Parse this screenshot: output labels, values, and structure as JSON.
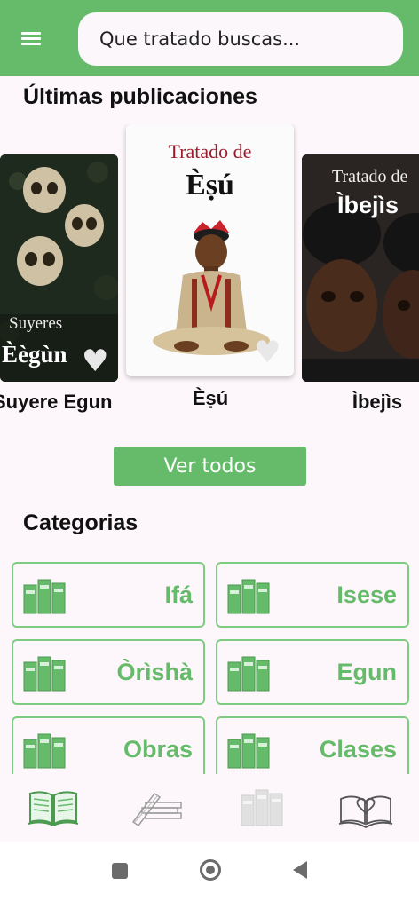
{
  "search": {
    "placeholder": "Que tratado buscas..."
  },
  "latest": {
    "title": "Últimas publicaciones",
    "books": [
      {
        "caption": "Suyere Egun",
        "cover_line1": "Suyeres",
        "cover_line2": "Èègùn"
      },
      {
        "caption": "Èṣú",
        "cover_line1": "Tratado de",
        "cover_line2": "Èṣú"
      },
      {
        "caption": "Ìbejìs",
        "cover_line1": "Tratado de",
        "cover_line2": "Ìbejìs"
      }
    ],
    "see_all_label": "Ver todos"
  },
  "categories": {
    "title": "Categorias",
    "items": [
      {
        "label": "Ifá"
      },
      {
        "label": "Isese"
      },
      {
        "label": "Òrìshà"
      },
      {
        "label": "Egun"
      },
      {
        "label": "Obras"
      },
      {
        "label": "Clases"
      }
    ]
  },
  "bottom_nav": {
    "items": [
      {
        "icon": "open-book-icon",
        "active": true
      },
      {
        "icon": "pen-and-papers-icon",
        "active": false
      },
      {
        "icon": "books-shelf-icon",
        "active": false
      },
      {
        "icon": "book-heart-icon",
        "active": false
      }
    ]
  },
  "colors": {
    "accent": "#66bb6a",
    "background": "#fdf7fb",
    "cover_red": "#9b1c2c"
  }
}
